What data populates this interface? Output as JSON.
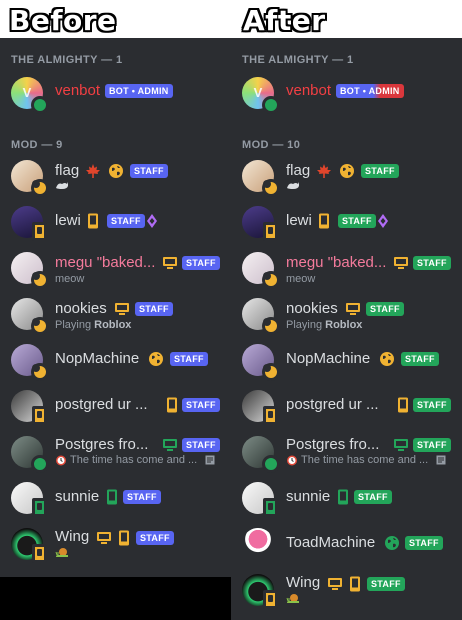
{
  "headings": {
    "before": "Before",
    "after": "After"
  },
  "sections": {
    "almighty": "THE ALMIGHTY — 1",
    "mod_before": "MOD — 9",
    "mod_after": "MOD — 10"
  },
  "badges": {
    "bot": "BOT • ADMIN",
    "staff": "STAFF"
  },
  "members": {
    "venbot": "venbot",
    "flag": "flag",
    "lewi": "lewi",
    "megu": "megu \"baked...",
    "megu_sub": "meow",
    "nookies": "nookies",
    "nookies_sub_prefix": "Playing ",
    "nookies_sub_game": "Roblox",
    "nopmachine": "NopMachine",
    "postgred": "postgred ur ...",
    "postgres": "Postgres fro...",
    "postgres_sub": "The time has come and ...",
    "sunnie": "sunnie",
    "toadmachine": "ToadMachine",
    "wing": "Wing"
  },
  "colors": {
    "panel": "#2b2d31",
    "text": "#dbdee1",
    "muted": "#949ba4",
    "red_name": "#f23f43",
    "pink_name": "#f47b9c",
    "staff_before": "#5865f2",
    "staff_after": "#23a55a",
    "online": "#23a55a",
    "idle": "#f0b232"
  },
  "icons": [
    "maple-leaf-icon",
    "globe-icon",
    "phone-icon",
    "desktop-icon",
    "nitro-gem-icon",
    "alarm-clock-icon",
    "note-icon",
    "snail-icon",
    "cat-icon"
  ]
}
